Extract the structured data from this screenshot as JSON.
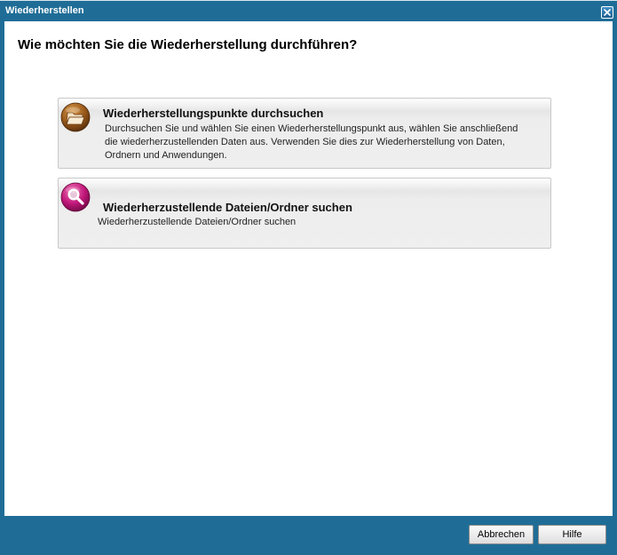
{
  "window": {
    "title": "Wiederherstellen",
    "close_icon": "close-icon"
  },
  "main": {
    "heading": "Wie möchten Sie die Wiederherstellung durchführen?",
    "options": [
      {
        "icon": "folder-open-icon",
        "title": "Wiederherstellungspunkte durchsuchen",
        "description": "Durchsuchen Sie und wählen Sie einen Wiederherstellungspunkt aus, wählen Sie anschließend die wiederherzustellenden Daten aus. Verwenden Sie dies zur Wiederherstellung von Daten, Ordnern und Anwendungen."
      },
      {
        "icon": "magnifier-icon",
        "title": "Wiederherzustellende Dateien/Ordner suchen",
        "description": "Wiederherzustellende Dateien/Ordner suchen"
      }
    ]
  },
  "footer": {
    "cancel_label": "Abbrechen",
    "help_label": "Hilfe"
  },
  "colors": {
    "titlebar": "#1f6d97",
    "folder_icon": "#9a5a1c",
    "search_icon": "#c2187b"
  }
}
